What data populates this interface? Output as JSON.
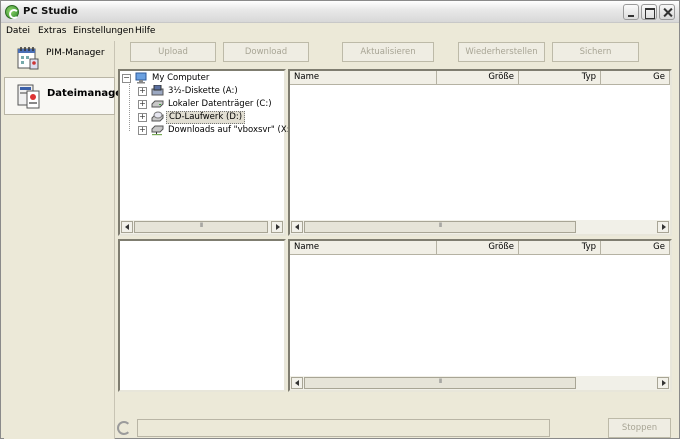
{
  "window": {
    "title": "PC Studio"
  },
  "menu": [
    "Datei",
    "Extras",
    "Einstellungen",
    "Hilfe"
  ],
  "sidebar": {
    "items": [
      {
        "label": "PIM-Manager",
        "icon": "pim-manager-icon",
        "selected": false
      },
      {
        "label": "Dateimanager",
        "icon": "file-manager-icon",
        "selected": true
      }
    ]
  },
  "toolbar": {
    "upload": "Upload",
    "download": "Download",
    "refresh": "Aktualisieren",
    "restore": "Wiederherstellen",
    "backup": "Sichern"
  },
  "tree": {
    "root": "My Computer",
    "nodes": [
      {
        "label": "3½-Diskette (A:)",
        "icon": "floppy-drive-icon"
      },
      {
        "label": "Lokaler Datenträger (C:)",
        "icon": "hard-drive-icon"
      },
      {
        "label": "CD-Laufwerk (D:)",
        "icon": "cd-drive-icon",
        "selected": true
      },
      {
        "label": "Downloads auf \"vboxsvr\" (X:)",
        "icon": "network-drive-icon"
      }
    ]
  },
  "file_list": {
    "columns": [
      "Name",
      "Größe",
      "Typ",
      "Ge"
    ]
  },
  "status": {
    "stop_label": "Stoppen"
  }
}
